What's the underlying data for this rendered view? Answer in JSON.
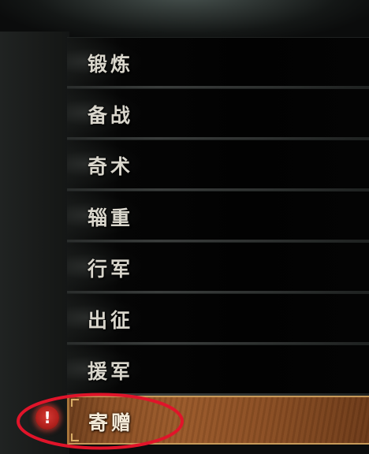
{
  "menu": {
    "items": [
      {
        "label": "锻炼",
        "selected": false
      },
      {
        "label": "备战",
        "selected": false
      },
      {
        "label": "奇术",
        "selected": false
      },
      {
        "label": "辎重",
        "selected": false
      },
      {
        "label": "行军",
        "selected": false
      },
      {
        "label": "出征",
        "selected": false
      },
      {
        "label": "援军",
        "selected": false
      },
      {
        "label": "寄赠",
        "selected": true
      }
    ]
  },
  "alert": {
    "icon": "exclamation-icon",
    "glyph": "!",
    "color": "#c42a24"
  },
  "annotation": {
    "ring_color": "#e0142a"
  },
  "colors": {
    "selected_bg": "#8f5226",
    "selected_border": "#c79a5a",
    "item_bg": "#030303",
    "label_text": "#d9d6cc"
  }
}
